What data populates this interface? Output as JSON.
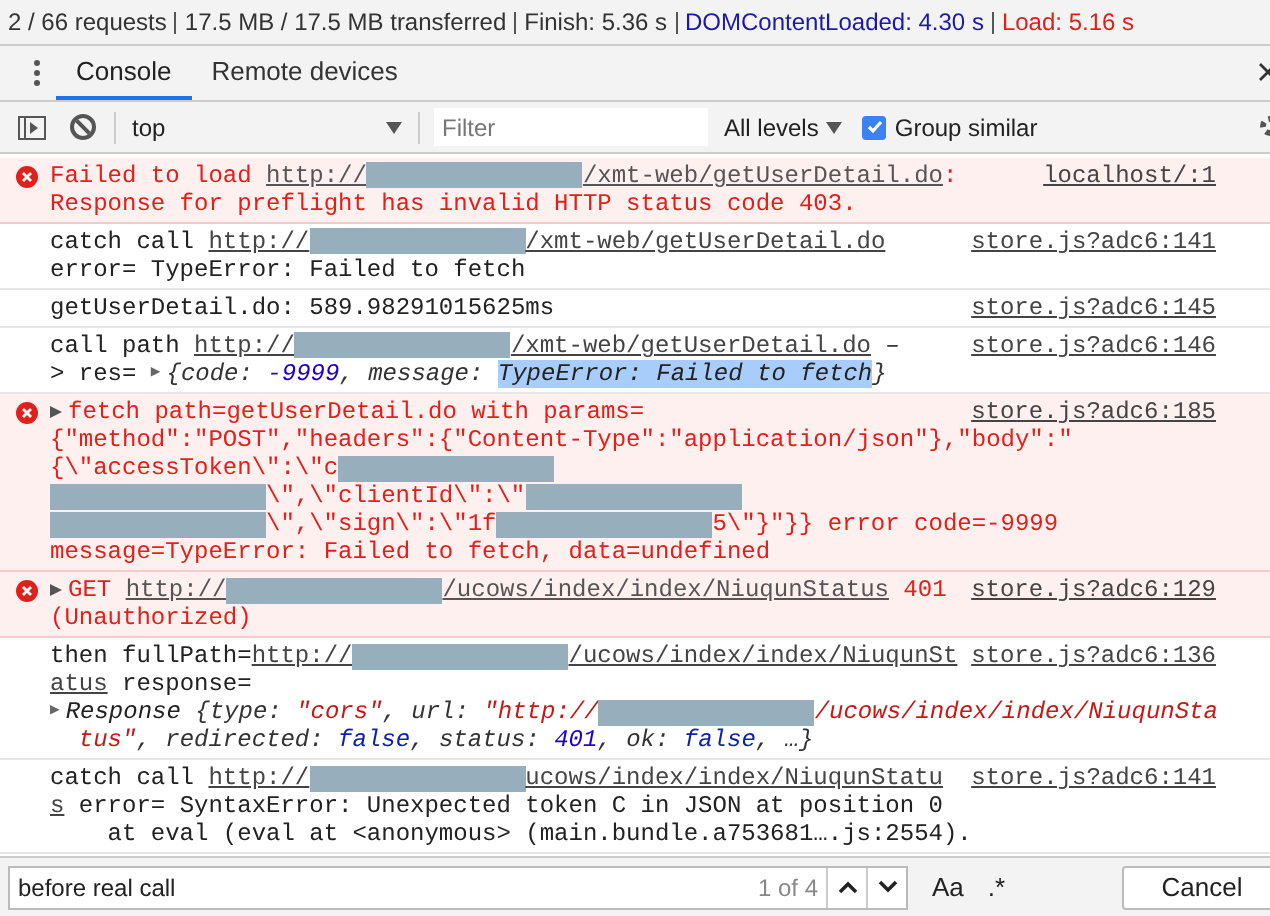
{
  "status_bar": [
    {
      "kind": "plain",
      "text": "2 / 66 requests"
    },
    {
      "kind": "plain",
      "text": "17.5 MB / 17.5 MB transferred"
    },
    {
      "kind": "plain",
      "text": "Finish: 5.36 s"
    },
    {
      "kind": "dom",
      "text": "DOMContentLoaded: 4.30 s"
    },
    {
      "kind": "load",
      "text": "Load: 5.16 s"
    }
  ],
  "tabs": [
    {
      "label": "Console",
      "selected": true
    },
    {
      "label": "Remote devices",
      "selected": false
    }
  ],
  "toolbar": {
    "context": "top",
    "filter_placeholder": "Filter",
    "levels": "All levels",
    "group_similar": {
      "label": "Group similar",
      "checked": true
    }
  },
  "messages": [
    {
      "kind": "error",
      "expandable": false,
      "source": "localhost/:1",
      "lines": [
        [
          {
            "kind": "text",
            "text": "Failed to load "
          },
          {
            "kind": "link",
            "text": "http://"
          },
          {
            "kind": "redacted"
          },
          {
            "kind": "link",
            "text": "/xmt-web/getUserDetail.do"
          },
          {
            "kind": "text",
            "text": ":"
          }
        ],
        [
          {
            "kind": "text",
            "text": "Response for preflight has invalid HTTP status code 403."
          }
        ]
      ]
    },
    {
      "kind": "log",
      "expandable": false,
      "source": "store.js?adc6:141",
      "lines": [
        [
          {
            "kind": "text",
            "text": "catch call "
          },
          {
            "kind": "link",
            "text": "http://"
          },
          {
            "kind": "redacted"
          },
          {
            "kind": "link",
            "text": "/xmt-web/getUserDetail.do"
          }
        ],
        [
          {
            "kind": "text",
            "text": "error= TypeError: Failed to fetch"
          }
        ]
      ]
    },
    {
      "kind": "log",
      "expandable": false,
      "source": "store.js?adc6:145",
      "lines": [
        [
          {
            "kind": "text",
            "text": "getUserDetail.do: 589.98291015625ms"
          }
        ]
      ]
    },
    {
      "kind": "log",
      "expandable": false,
      "source": "store.js?adc6:146",
      "lines": [
        [
          {
            "kind": "text",
            "text": "call path "
          },
          {
            "kind": "link",
            "text": "http://"
          },
          {
            "kind": "redacted"
          },
          {
            "kind": "link",
            "text": "/xmt-web/getUserDetail.do"
          },
          {
            "kind": "text",
            "text": " –"
          }
        ],
        [
          {
            "kind": "text",
            "text": "> res= "
          },
          {
            "kind": "toggle",
            "text": "▶"
          },
          {
            "kind": "obj",
            "text": "{code: "
          },
          {
            "kind": "num",
            "text": "-9999"
          },
          {
            "kind": "obj",
            "text": ", message: "
          },
          {
            "kind": "highlight",
            "text": "TypeError: Failed to fetch"
          },
          {
            "kind": "obj",
            "text": "}"
          }
        ]
      ]
    },
    {
      "kind": "error",
      "expandable": true,
      "source": "store.js?adc6:185",
      "lines": [
        [
          {
            "kind": "text",
            "text": "fetch path=getUserDetail.do with params="
          }
        ],
        [
          {
            "kind": "text",
            "text": "{\"method\":\"POST\",\"headers\":{\"Content-Type\":\"application/json\"},\"body\":\""
          }
        ],
        [
          {
            "kind": "text",
            "text": "{\\\"accessToken\\\":\\\"c"
          },
          {
            "kind": "redacted"
          }
        ],
        [
          {
            "kind": "redacted"
          },
          {
            "kind": "text",
            "text": "\\\",\\\"clientId\\\":\\\""
          },
          {
            "kind": "redacted"
          }
        ],
        [
          {
            "kind": "redacted"
          },
          {
            "kind": "text",
            "text": "\\\",\\\"sign\\\":\\\"1f"
          },
          {
            "kind": "redacted"
          },
          {
            "kind": "text",
            "text": "5\\\"}\"}} error code=-9999"
          }
        ],
        [
          {
            "kind": "text",
            "text": "message=TypeError: Failed to fetch, data=undefined"
          }
        ]
      ]
    },
    {
      "kind": "error",
      "expandable": true,
      "source": "store.js?adc6:129",
      "lines": [
        [
          {
            "kind": "text",
            "text": "GET "
          },
          {
            "kind": "link",
            "text": "http://"
          },
          {
            "kind": "redacted"
          },
          {
            "kind": "link",
            "text": "/ucows/index/index/NiuqunStatus"
          },
          {
            "kind": "text",
            "text": " 401"
          }
        ],
        [
          {
            "kind": "text",
            "text": "(Unauthorized)"
          }
        ]
      ]
    },
    {
      "kind": "log",
      "expandable": false,
      "source": "store.js?adc6:136",
      "lines": [
        [
          {
            "kind": "text",
            "text": "then fullPath="
          },
          {
            "kind": "link",
            "text": "http://"
          },
          {
            "kind": "redacted"
          },
          {
            "kind": "link",
            "text": "/ucows/index/index/NiuqunSt"
          }
        ],
        [
          {
            "kind": "link",
            "text": "atus"
          },
          {
            "kind": "text",
            "text": " response="
          }
        ],
        [
          {
            "kind": "toggle",
            "text": "▶"
          },
          {
            "kind": "objname",
            "text": "Response "
          },
          {
            "kind": "obj",
            "text": "{type: "
          },
          {
            "kind": "str",
            "text": "\"cors\""
          },
          {
            "kind": "obj",
            "text": ", url: "
          },
          {
            "kind": "str",
            "text": "\"http://"
          },
          {
            "kind": "redacted"
          },
          {
            "kind": "str",
            "text": "/ucows/index/index/NiuqunSta"
          }
        ],
        [
          {
            "kind": "str",
            "text": "  tus\""
          },
          {
            "kind": "obj",
            "text": ", redirected: "
          },
          {
            "kind": "kw",
            "text": "false"
          },
          {
            "kind": "obj",
            "text": ", status: "
          },
          {
            "kind": "num",
            "text": "401"
          },
          {
            "kind": "obj",
            "text": ", ok: "
          },
          {
            "kind": "kw",
            "text": "false"
          },
          {
            "kind": "obj",
            "text": ", …}"
          }
        ]
      ]
    },
    {
      "kind": "log",
      "expandable": false,
      "source": "store.js?adc6:141",
      "lines": [
        [
          {
            "kind": "text",
            "text": "catch call "
          },
          {
            "kind": "link",
            "text": "http://"
          },
          {
            "kind": "redacted"
          },
          {
            "kind": "link",
            "text": "ucows/index/index/NiuqunStatu"
          }
        ],
        [
          {
            "kind": "link",
            "text": "s"
          },
          {
            "kind": "text",
            "text": " error= SyntaxError: Unexpected token C in JSON at position 0"
          }
        ],
        [
          {
            "kind": "text",
            "text": "    at eval (eval at <anonymous> (main.bundle.a753681….js:2554)."
          }
        ]
      ]
    }
  ],
  "search": {
    "value": "before real call",
    "count": "1 of 4",
    "match_case": "Aa",
    "regex": ".*",
    "cancel": "Cancel"
  }
}
